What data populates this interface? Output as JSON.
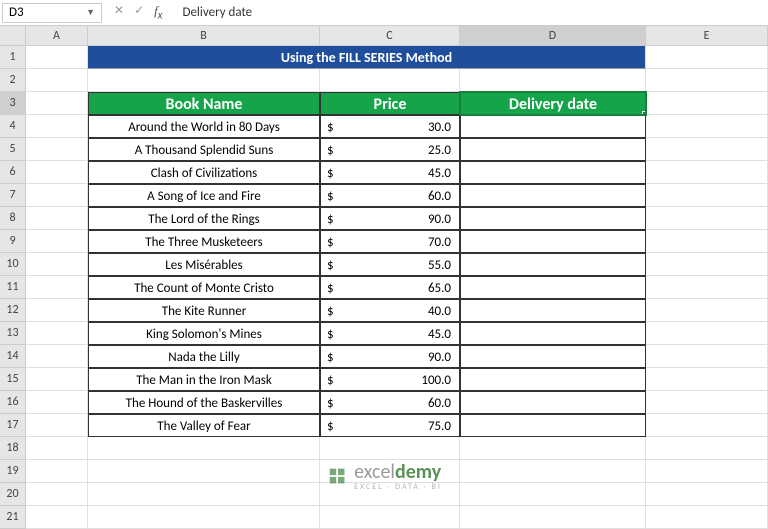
{
  "formula_bar": {
    "namebox": "D3",
    "value": "Delivery date"
  },
  "columns": [
    "A",
    "B",
    "C",
    "D",
    "E"
  ],
  "rows": [
    1,
    2,
    3,
    4,
    5,
    6,
    7,
    8,
    9,
    10,
    11,
    12,
    13,
    14,
    15,
    16,
    17,
    18,
    19,
    20,
    21
  ],
  "title": "Using the FILL SERIES Method",
  "headers": {
    "b": "Book Name",
    "c": "Price",
    "d": "Delivery date"
  },
  "data": [
    {
      "name": "Around the World in 80 Days",
      "price": "30.0"
    },
    {
      "name": "A Thousand Splendid Suns",
      "price": "25.0"
    },
    {
      "name": "Clash of Civilizations",
      "price": "45.0"
    },
    {
      "name": "A Song of Ice and Fire",
      "price": "60.0"
    },
    {
      "name": "The Lord of the Rings",
      "price": "90.0"
    },
    {
      "name": "The Three Musketeers",
      "price": "70.0"
    },
    {
      "name": "Les Misérables",
      "price": "55.0"
    },
    {
      "name": "The Count of Monte Cristo",
      "price": "65.0"
    },
    {
      "name": "The Kite Runner",
      "price": "40.0"
    },
    {
      "name": "King Solomon's Mines",
      "price": "45.0"
    },
    {
      "name": "Nada the Lilly",
      "price": "90.0"
    },
    {
      "name": "The Man in the Iron Mask",
      "price": "100.0"
    },
    {
      "name": "The Hound of the Baskervilles",
      "price": "60.0"
    },
    {
      "name": "The Valley of Fear",
      "price": "75.0"
    }
  ],
  "currency": "$",
  "selected_cell": "D3",
  "watermark": {
    "brand_prefix": "excel",
    "brand_bold": "demy",
    "tagline": "EXCEL · DATA · BI"
  },
  "chart_data": {
    "type": "table",
    "title": "Using the FILL SERIES Method",
    "columns": [
      "Book Name",
      "Price",
      "Delivery date"
    ],
    "rows": [
      [
        "Around the World in 80 Days",
        30.0,
        null
      ],
      [
        "A Thousand Splendid Suns",
        25.0,
        null
      ],
      [
        "Clash of Civilizations",
        45.0,
        null
      ],
      [
        "A Song of Ice and Fire",
        60.0,
        null
      ],
      [
        "The Lord of the Rings",
        90.0,
        null
      ],
      [
        "The Three Musketeers",
        70.0,
        null
      ],
      [
        "Les Misérables",
        55.0,
        null
      ],
      [
        "The Count of Monte Cristo",
        65.0,
        null
      ],
      [
        "The Kite Runner",
        40.0,
        null
      ],
      [
        "King Solomon's Mines",
        45.0,
        null
      ],
      [
        "Nada the Lilly",
        90.0,
        null
      ],
      [
        "The Man in the Iron Mask",
        100.0,
        null
      ],
      [
        "The Hound of the Baskervilles",
        60.0,
        null
      ],
      [
        "The Valley of Fear",
        75.0,
        null
      ]
    ]
  }
}
